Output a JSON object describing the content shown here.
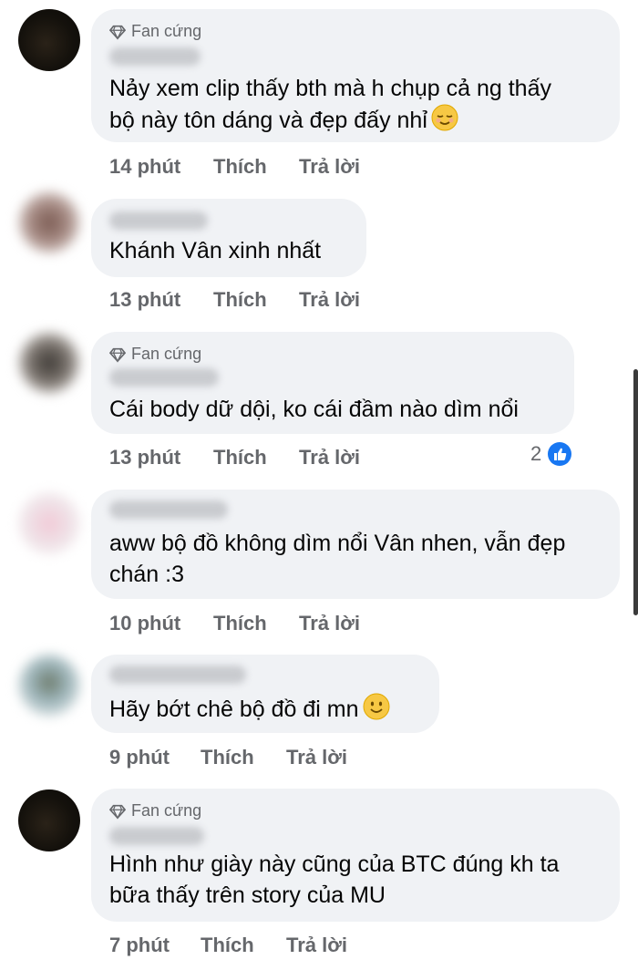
{
  "badge_label": "Fan cứng",
  "actions": {
    "like": "Thích",
    "reply": "Trả lời"
  },
  "comments": [
    {
      "text_lines": [
        "Nảy xem clip thấy bth mà h chụp cả ng thấy",
        "bộ này tôn dáng và đẹp đấy nhỉ"
      ],
      "emoji": "relieved-face-icon",
      "time": "14 phút"
    },
    {
      "text_lines": [
        "Khánh Vân xinh nhất"
      ],
      "time": "13 phút"
    },
    {
      "text_lines": [
        "Cái body dữ dội, ko cái đầm nào dìm nổi"
      ],
      "time": "13 phút",
      "reaction_count": "2"
    },
    {
      "text_lines": [
        "aww bộ đồ không dìm nổi Vân nhen, vẫn đẹp",
        "chán :3"
      ],
      "time": "10 phút"
    },
    {
      "text_lines": [
        "Hãy bớt chê bộ đồ đi mn"
      ],
      "emoji": "smiling-face-icon",
      "time": "9 phút"
    },
    {
      "text_lines": [
        "Hình như giày này cũng của BTC đúng kh ta",
        "bữa thấy trên story của MU"
      ],
      "time": "7 phút"
    }
  ],
  "colors": {
    "bubble": "#f0f2f5",
    "meta_text": "#65676b",
    "like_blue": "#1877f2",
    "emoji_yellow": "#f7c844"
  }
}
